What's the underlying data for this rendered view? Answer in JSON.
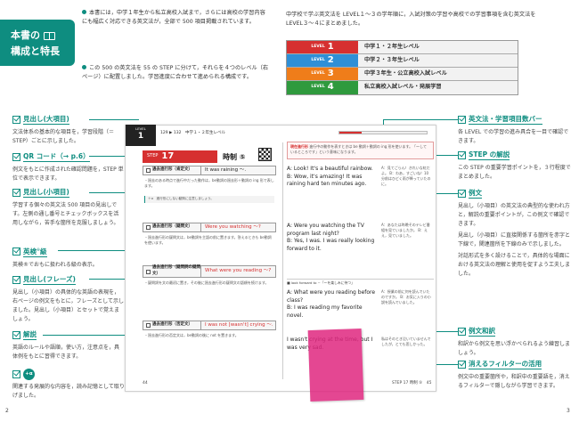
{
  "title": {
    "line1": "本書の",
    "line2": "構成と特長"
  },
  "intro": [
    "本書には，中学１年生から私立高校入試まで，さらには高校の学習内容にも幅広く対応できる英文法が，全部で 500 項目掲載されています。",
    "この 500 の英文法を 55 の STEP に分けて，それらを４つのレベル（右ページ）に配置しました。学習進度に合わせて進められる構成です。"
  ],
  "right_intro": "中学校で学ぶ英文法を LEVEL１～３の学年順に，入試対策の学習や高校での学習事項を含む英文法を LEVEL３～４にまとめました。",
  "levels": [
    {
      "word": "LEVEL",
      "num": "1",
      "desc": "中学１・２年生レベル",
      "color": "#d63030"
    },
    {
      "word": "LEVEL",
      "num": "2",
      "desc": "中学２・３年生レベル",
      "color": "#2f8fd6"
    },
    {
      "word": "LEVEL",
      "num": "3",
      "desc": "中学３年生・公立高校入試レベル",
      "color": "#ef7d1a"
    },
    {
      "word": "LEVEL",
      "num": "4",
      "desc": "私立高校入試レベル・発展学習",
      "color": "#2f9a3e"
    }
  ],
  "left_sections": [
    {
      "title": "見出し(大項目)",
      "desc": "文法体系の基本的な項目を，学習段階（＝STEP）ごとに示しました。"
    },
    {
      "title": "QR コード（→ p.6）",
      "desc": "例文をもとに作成された確認問題を，STEP 単位で表示できます。"
    },
    {
      "title": "見出し(小項目)",
      "desc": "学習する個々の英文法 500 項目の見出しです。左側の通し番号とチェックボックスを活用しながら，苦手な箇所を克服しましょう。"
    },
    {
      "title": "英検",
      "sup": "®",
      "title_tail": "級",
      "desc": "英検®でおもに扱われる級の表示。"
    },
    {
      "title": "見出し(フレーズ)",
      "desc": "見出し（小項目）の具体的な英語の表現を，右ページの例文をもとに，フレーズとして示しました。見出し（小項目）とセットで覚えましょう。"
    },
    {
      "title": "解説",
      "desc": "英語のルールや語順，使い方，注意点を，具体例をもとに習得できます。"
    },
    {
      "title": "+α",
      "desc": "関連する発展的な内容を，読み記憶として取り上げました。"
    }
  ],
  "right_sections": [
    {
      "title": "英文法・学習項目数バー",
      "desc": "各 LEVEL での学習の進み具合を一目で確認できます。"
    },
    {
      "title": "STEP の解説",
      "desc": "この STEP の重要学習ポイントを，３行程度でまとめました。"
    },
    {
      "title": "例文",
      "desc": "見出し（小項目）の英文法の典型的な使われ方と，解説の重要ポイントが，この例文で確認できます。",
      "desc2": "見出し（小項目）に直接関係する箇所を赤字と下線で，関連箇所を下線のみで示しました。",
      "desc3": "対話形式を多く設けることで，具体的な場面における英文法の理解と使用を促すよう工夫しました。"
    },
    {
      "title": "例文和訳",
      "desc": "和訳から例文を思い浮かべられるよう練習しましょう。"
    },
    {
      "title": "消えるフィルターの活用",
      "desc": "例文中の重要箇所や，和訳中の重要語を，消えるフィルターで隠しながら学習できます。"
    }
  ],
  "sample": {
    "level_word": "LEVEL",
    "level_num": "1",
    "top_text": "129 ▶ 132　中学１・２年生レベル",
    "step_word": "STEP",
    "step_num": "17",
    "step_title": "時制 ⑤",
    "point_label": "現在進行形",
    "point_text": "進行中の動作を表すときは be 動詞＋動詞の ing 形を使います。「～しているところです」という意味になります。",
    "items": [
      {
        "label": "過去進行形（肯定文）",
        "phrase": "It was raining 〜.",
        "ex1": "A: Look! It's a beautiful rainbow.",
        "ex2": "B: Wow, it's amazing! It was raining hard ten minutes ago.",
        "jp": "A：見てごらん！きれいな虹だよ。 B：わあ，すごいね！10 分前はひどく雨が降っていたのに。"
      },
      {
        "label": "過去進行形（疑問文）",
        "phrase": "Were you watching 〜?",
        "ex1": "A: Were you watching the TV program last night?",
        "ex2": "B: Yes, I was. I was really looking forward to it.",
        "jp": "A：あなたは昨晩そのテレビ番組を見ていましたか。 B：ええ，見ていました。"
      },
      {
        "label": "過去進行形（疑問詞の疑問文）",
        "phrase": "What were you reading 〜?",
        "ex1": "A: What were you reading before class?",
        "ex2": "B: I was reading my favorite novel.",
        "jp": "A：授業の前に何を読んでいたのですか。 B：お気に入りの小説を読んでいました。"
      },
      {
        "label": "過去進行形（否定文）",
        "phrase": "I was not [wasn't] crying 〜.",
        "ex1": "I wasn't crying at the time, but I was very sad.",
        "ex2": "",
        "jp": "私はそのとき泣いていませんでしたが，とても悲しかった。"
      }
    ],
    "phrase_bar": "■ look forward to ~「～を楽しみに待つ」",
    "page_left": "44",
    "page_right": "STEP 17 時制 ⑤　45"
  },
  "page_numbers": {
    "left": "2",
    "right": "3"
  },
  "progress_fraction": 0.25
}
